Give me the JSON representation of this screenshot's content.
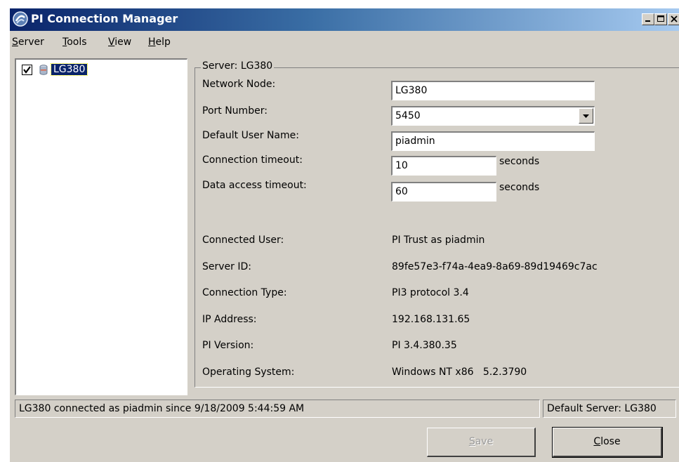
{
  "window": {
    "title": "PI Connection Manager",
    "controls": {
      "minimize": "minimize",
      "maximize": "maximize",
      "close": "close"
    }
  },
  "menu": [
    {
      "accel": "S",
      "rest": "erver"
    },
    {
      "accel": "T",
      "rest": "ools"
    },
    {
      "accel": "V",
      "rest": "iew"
    },
    {
      "accel": "H",
      "rest": "elp"
    }
  ],
  "tree": {
    "items": [
      {
        "label": "LG380",
        "checked": true,
        "selected": true
      }
    ]
  },
  "server_group": {
    "title": "Server: LG380",
    "fields": {
      "network_node": {
        "label": "Network Node:",
        "value": "LG380"
      },
      "port_number": {
        "label": "Port Number:",
        "value": "5450"
      },
      "default_user": {
        "label": "Default User Name:",
        "value": "piadmin"
      },
      "connection_timeout": {
        "label": "Connection timeout:",
        "value": "10",
        "unit": "seconds"
      },
      "data_access_timeout": {
        "label": "Data access timeout:",
        "value": "60",
        "unit": "seconds"
      }
    },
    "info": {
      "connected_user": {
        "label": "Connected User:",
        "value": "PI Trust as piadmin"
      },
      "server_id": {
        "label": "Server ID:",
        "value": "89fe57e3-f74a-4ea9-8a69-89d19469c7ac"
      },
      "connection_type": {
        "label": "Connection Type:",
        "value": "PI3 protocol 3.4"
      },
      "ip_address": {
        "label": "IP Address:",
        "value": "192.168.131.65"
      },
      "pi_version": {
        "label": "PI Version:",
        "value": "PI 3.4.380.35"
      },
      "operating_system": {
        "label": "Operating System:",
        "value": "Windows NT x86   5.2.3790"
      }
    }
  },
  "status_bar": {
    "left": "LG380 connected as piadmin since 9/18/2009 5:44:59 AM",
    "right": "Default Server: LG380"
  },
  "buttons": {
    "save": {
      "accel": "S",
      "rest": "ave",
      "enabled": false
    },
    "close": {
      "accel": "C",
      "rest": "lose",
      "enabled": true
    }
  },
  "colors": {
    "face": "#d4d0c8",
    "title_start": "#0a246a",
    "title_end": "#a6caf0",
    "selection": "#0a246a"
  }
}
